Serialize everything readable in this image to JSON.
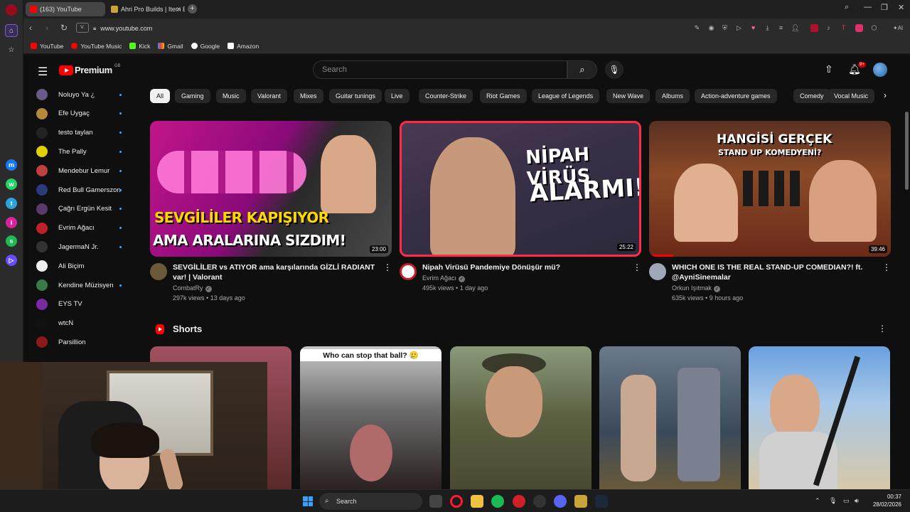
{
  "browser": {
    "tabs": [
      {
        "label": "(163) YouTube",
        "active": true
      },
      {
        "label": "Ahri Pro Builds | Item Build",
        "active": false
      }
    ],
    "url": "www.youtube.com",
    "bookmarks": [
      "YouTube",
      "YouTube Music",
      "Kick",
      "Gmail",
      "Google",
      "Amazon"
    ],
    "ai_label": "AI"
  },
  "header": {
    "brand": "Premium",
    "country_code": "GB",
    "search_placeholder": "Search",
    "notif_badge": "9+"
  },
  "subscriptions": [
    {
      "name": "Noluyo Ya ¿",
      "color": "#6a5a8a",
      "dot": true
    },
    {
      "name": "Efe Uygaç",
      "color": "#b48a3a",
      "dot": true
    },
    {
      "name": "testo taylan",
      "color": "#222222",
      "dot": true
    },
    {
      "name": "The Pally",
      "color": "#e2d000",
      "dot": true
    },
    {
      "name": "Mendebur Lemur",
      "color": "#c04040",
      "dot": true
    },
    {
      "name": "Red Bull Gamerszon",
      "color": "#2b3a78",
      "dot": true
    },
    {
      "name": "Çağrı Ergün Kesit",
      "color": "#5a3a6a",
      "dot": true
    },
    {
      "name": "Evrim Ağacı",
      "color": "#c0202a",
      "dot": true
    },
    {
      "name": "JagermaN Jr.",
      "color": "#333333",
      "dot": true
    },
    {
      "name": "Ali Biçim",
      "color": "#eeeeee",
      "dot": false
    },
    {
      "name": "Kendine Müzisyen",
      "color": "#3a7a4a",
      "dot": true
    },
    {
      "name": "EYS TV",
      "color": "#7a2aa0",
      "dot": false
    },
    {
      "name": "wtcN",
      "color": "#111111",
      "dot": false
    },
    {
      "name": "Parsillion",
      "color": "#8a1a1a",
      "dot": false
    }
  ],
  "chips": [
    "All",
    "Gaming",
    "Music",
    "Valorant",
    "Mixes",
    "Guitar tunings",
    "Live",
    "Counter-Strike",
    "Riot Games",
    "League of Legends",
    "New Wave",
    "Albums",
    "Action-adventure games",
    "Comedy",
    "Vocal Music"
  ],
  "videos": [
    {
      "title": "SEVGİLİLER vs ATIYOR ama karşılarında GİZLİ RADIANT var! | Valorant",
      "channel": "CombatRy",
      "views": "297k views",
      "age": "13 days ago",
      "duration": "23:00",
      "thumb_text_1": "SEVGİLİLER KAPIŞIYOR",
      "thumb_text_2": "AMA ARALARINA SIZDIM!"
    },
    {
      "title": "Nipah Virüsü Pandemiye Dönüşür mü?",
      "channel": "Evrim Ağacı",
      "views": "495k views",
      "age": "1 day ago",
      "duration": "25:22",
      "thumb_text_1": "NİPAH VİRÜS",
      "thumb_text_2": "ALARMI!"
    },
    {
      "title": "WHICH ONE IS THE REAL STAND-UP COMEDIAN?! ft. @AyniSinemalar",
      "channel": "Orkun Işıtmak",
      "views": "635k views",
      "age": "9 hours ago",
      "duration": "39:46",
      "thumb_text_1": "HANGİSİ GERÇEK",
      "thumb_text_2": "STAND UP KOMEDYENİ?",
      "watched": 0.1
    }
  ],
  "shorts": {
    "label": "Shorts",
    "items": [
      {
        "caption": ""
      },
      {
        "caption": "Who can stop that ball? 🥲"
      },
      {
        "caption": ""
      },
      {
        "caption": ""
      },
      {
        "caption": ""
      }
    ]
  },
  "taskbar": {
    "search_label": "Search",
    "time": "00:37",
    "date": "28/02/2026"
  }
}
